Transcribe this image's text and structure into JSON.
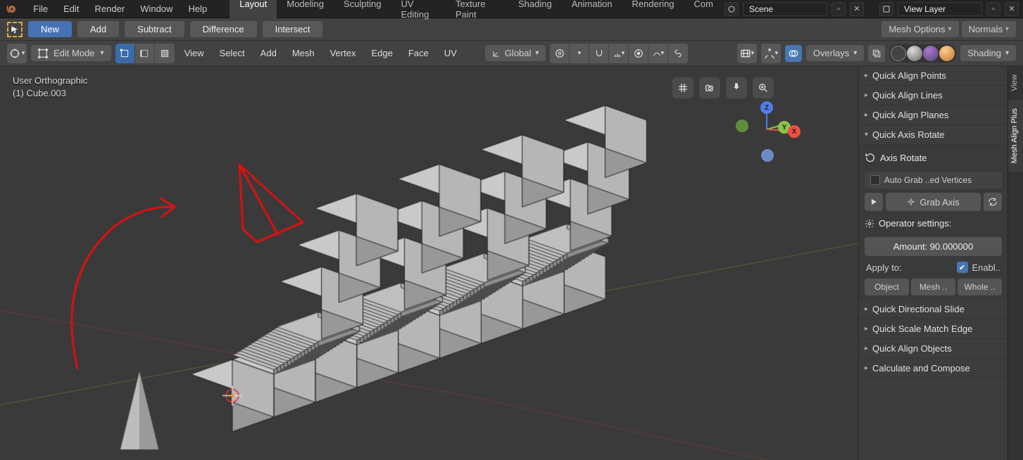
{
  "menubar": {
    "menus": [
      "File",
      "Edit",
      "Render",
      "Window",
      "Help"
    ],
    "tabs": [
      "Layout",
      "Modeling",
      "Sculpting",
      "UV Editing",
      "Texture Paint",
      "Shading",
      "Animation",
      "Rendering",
      "Com"
    ],
    "active_tab": 0,
    "scene_label": "Scene",
    "viewlayer_label": "View Layer"
  },
  "toolrow": {
    "new_label": "New",
    "add_label": "Add",
    "buttons": [
      "Subtract",
      "Difference",
      "Intersect"
    ],
    "mesh_options": "Mesh Options",
    "normals": "Normals"
  },
  "vp_header": {
    "mode": "Edit Mode",
    "menus": [
      "View",
      "Select",
      "Add",
      "Mesh",
      "Vertex",
      "Edge",
      "Face",
      "UV"
    ],
    "orientation": "Global",
    "overlays": "Overlays",
    "shading": "Shading"
  },
  "viewport": {
    "line1": "User Orthographic",
    "line2": "(1) Cube.003"
  },
  "npanel": {
    "items_top": [
      "Quick Align Points",
      "Quick Align Lines",
      "Quick Align Planes"
    ],
    "open_title": "Quick Axis Rotate",
    "axis_rotate": "Axis Rotate",
    "auto_grab": "Auto Grab ..ed Vertices",
    "grab_axis": "Grab Axis",
    "operator_settings": "Operator settings:",
    "amount_label": "Amount: 90.000000",
    "apply_to": "Apply to:",
    "enable": "Enabl..",
    "targets": [
      "Object",
      "Mesh ..",
      "Whole .."
    ],
    "items_bottom": [
      "Quick Directional Slide",
      "Quick Scale Match Edge",
      "Quick Align Objects",
      "Calculate and Compose"
    ]
  },
  "vertical_tabs": [
    "View",
    "Mesh Align Plus"
  ]
}
